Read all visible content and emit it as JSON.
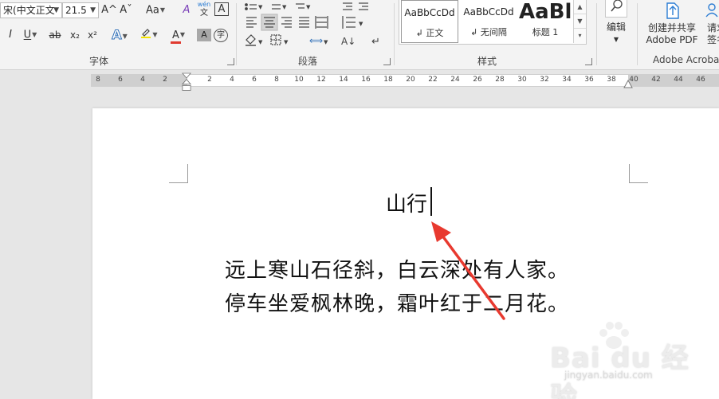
{
  "font_group": {
    "label": "字体",
    "font_name": "(中文正文",
    "font_name_prefix": "宋",
    "font_size": "21.5",
    "grow_font_icon": "A^",
    "shrink_font_icon": "Aˇ",
    "change_case": "Aa",
    "clear_format_icon": "A",
    "phonetic_top": "wén",
    "phonetic_bottom": "文",
    "char_border": "A",
    "italic": "I",
    "underline": "U",
    "strikethrough": "ab",
    "subscript": "x₂",
    "superscript": "x²",
    "text_effect": "A",
    "font_color": "A",
    "char_shading": "A",
    "enclose_char": "字"
  },
  "paragraph_group": {
    "label": "段落"
  },
  "styles_group": {
    "label": "样式",
    "items": [
      {
        "sample": "AaBbCcDd",
        "name": "正文"
      },
      {
        "sample": "AaBbCcDd",
        "name": "无间隔"
      },
      {
        "sample": "AaBl",
        "name": "标题 1"
      }
    ]
  },
  "editing": {
    "label": "编辑"
  },
  "acrobat": {
    "create_share_line1": "创建并共享",
    "create_share_line2": "Adobe PDF",
    "request_sign_line1": "请求",
    "request_sign_line2": "签名",
    "group_label": "Adobe Acrobat"
  },
  "ruler": {
    "left_ticks": [
      "8",
      "6",
      "4",
      "2"
    ],
    "right_ticks": [
      "2",
      "4",
      "6",
      "8",
      "10",
      "12",
      "14",
      "16",
      "18",
      "20",
      "22",
      "24",
      "26",
      "28",
      "30",
      "32",
      "34",
      "36",
      "38",
      "40",
      "42",
      "44",
      "46"
    ]
  },
  "document": {
    "title": "山行",
    "lines": [
      "远上寒山石径斜，白云深处有人家。",
      "停车坐爱枫林晚，霜叶红于二月花。"
    ]
  },
  "watermark": {
    "logo": "Bai du 经验",
    "url": "jingyan.baidu.com"
  },
  "colors": {
    "ribbon_bg": "#f3f3f3",
    "canvas_bg": "#e6e6e6",
    "highlight_yellow": "#f5e400",
    "font_color_red": "#e03a2f",
    "text_effect_blue": "#2f6fb8",
    "acrobat_blue": "#2b7cd3",
    "annotation_arrow": "#e8392f"
  }
}
